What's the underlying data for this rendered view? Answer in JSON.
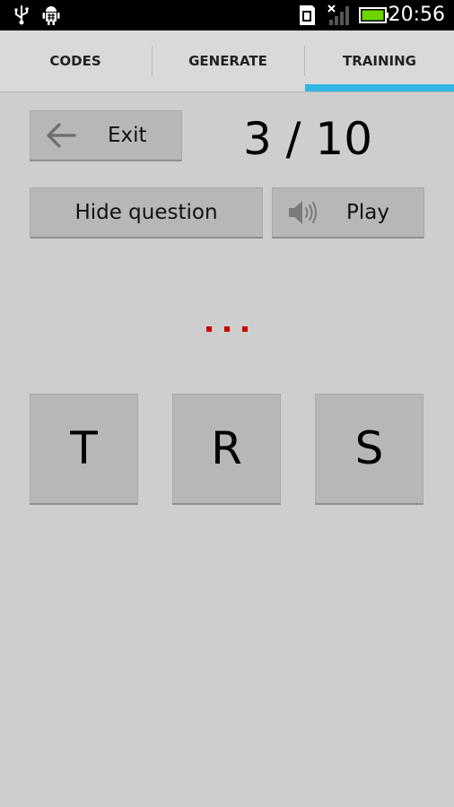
{
  "status_bar": {
    "time": "20:56",
    "icons": [
      "usb-icon",
      "android-debug-icon",
      "sd-card-icon",
      "signal-icon",
      "battery-icon"
    ]
  },
  "tabs": [
    {
      "label": "CODES",
      "selected": false
    },
    {
      "label": "GENERATE",
      "selected": false
    },
    {
      "label": "TRAINING",
      "selected": true
    }
  ],
  "training": {
    "exit_label": "Exit",
    "progress": "3 / 10",
    "hide_question_label": "Hide question",
    "play_label": "Play",
    "morse_question": "...",
    "answers": [
      "T",
      "R",
      "S"
    ]
  },
  "colors": {
    "tab_indicator": "#33b5e5",
    "morse_dot": "#cc0000",
    "background": "#cecece",
    "button": "#b7b7b7"
  }
}
